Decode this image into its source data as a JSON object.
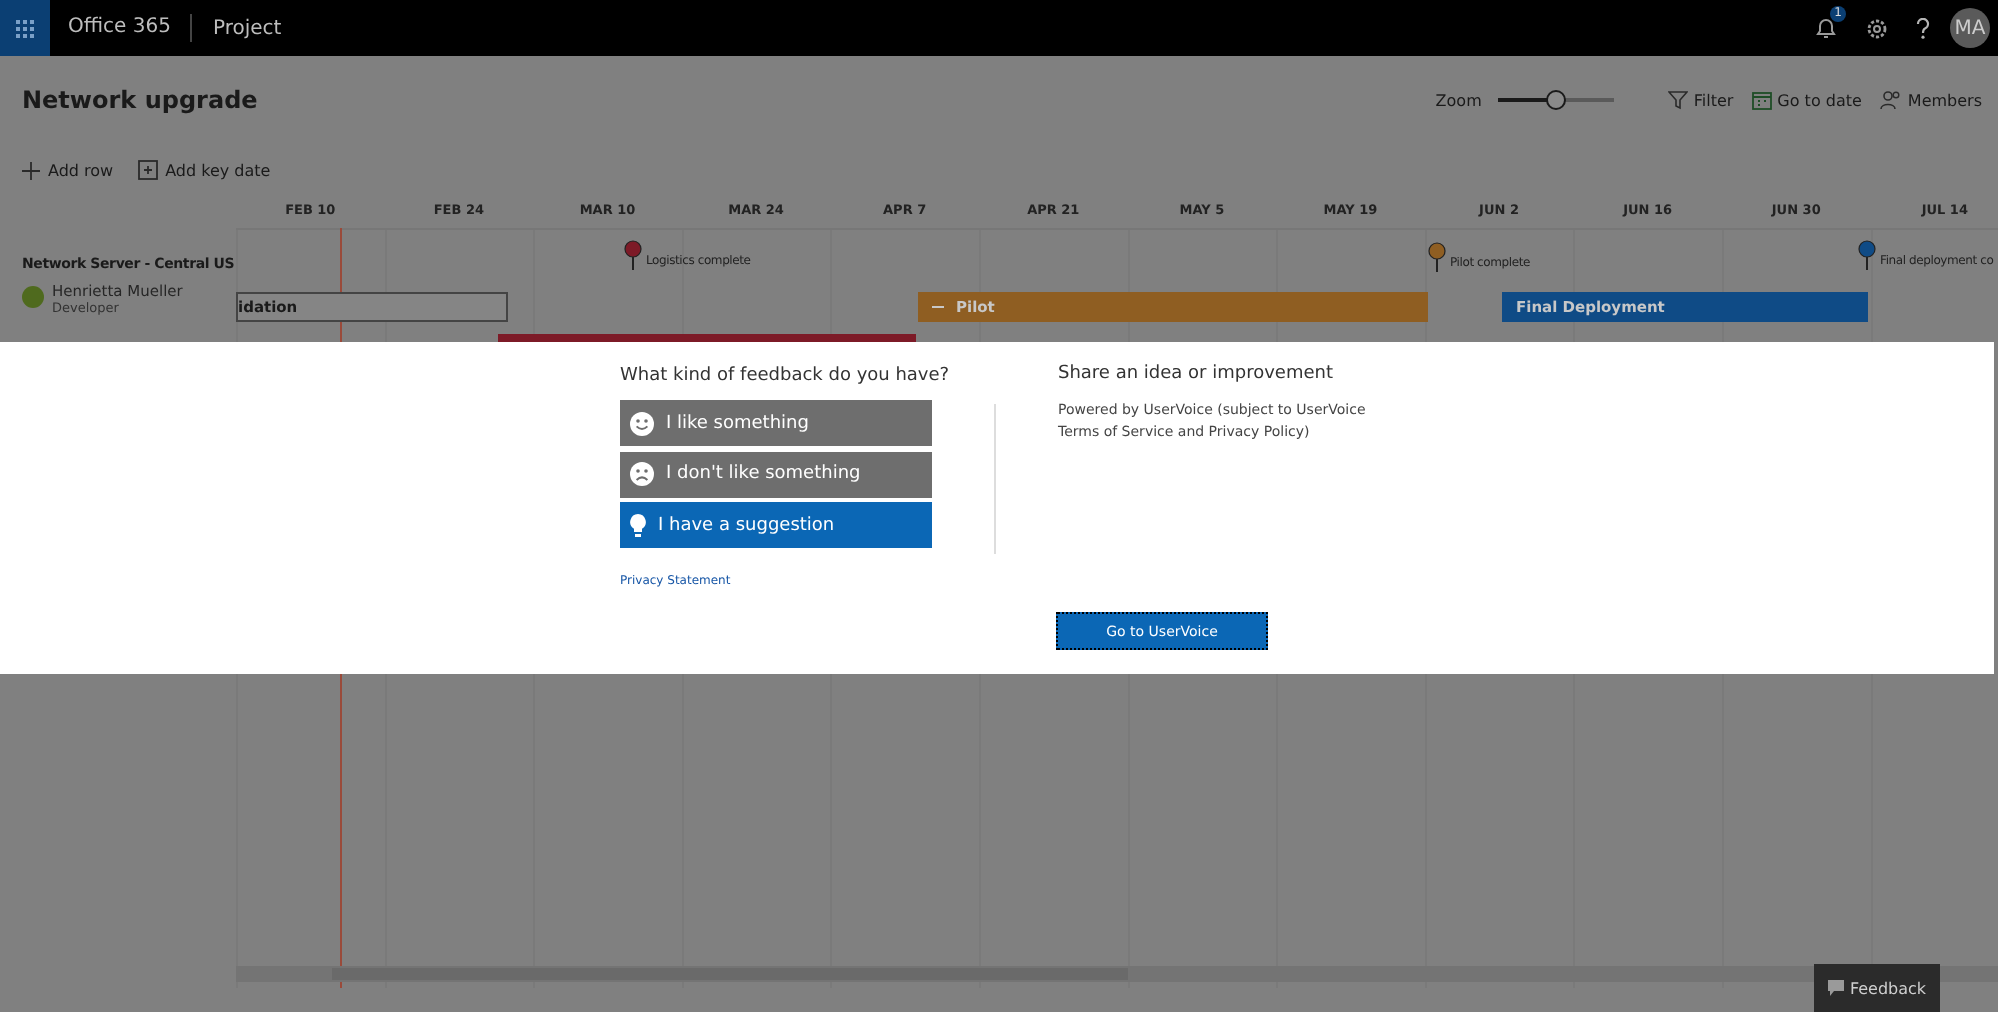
{
  "topbar": {
    "suite": "Office 365",
    "app": "Project",
    "notification_count": "1",
    "avatar": "MA"
  },
  "header": {
    "title": "Network upgrade",
    "zoom": {
      "label": "Zoom",
      "level": 0.5
    },
    "actions": [
      {
        "kind": "filter",
        "label": "Filter"
      },
      {
        "kind": "date",
        "label": "Go to date"
      },
      {
        "kind": "members",
        "label": "Members"
      }
    ]
  },
  "toolbar": [
    {
      "kind": "add",
      "label": "Add row"
    },
    {
      "kind": "keydate",
      "label": "Add key date"
    }
  ],
  "timeline": {
    "dates": [
      "FEB 10",
      "FEB 24",
      "MAR 10",
      "MAR 24",
      "APR 7",
      "APR 21",
      "MAY 5",
      "MAY 19",
      "JUN 2",
      "JUN 16",
      "JUN 30",
      "JUL 14"
    ],
    "row": {
      "name": "Network Server - Central US",
      "owner": "Henrietta Mueller",
      "role": "Developer"
    },
    "milestones": [
      {
        "label": "Logistics complete",
        "color": "#7d1a27"
      },
      {
        "label": "Pilot complete",
        "color": "#8f5e22"
      },
      {
        "label": "Final deployment co",
        "color": "#0f4b86"
      }
    ],
    "bars": [
      {
        "kind": "outlined",
        "label": "idation",
        "color": "#858585"
      },
      {
        "kind": "filled",
        "label": "Pilot",
        "color": "#8f5e22",
        "collapse": true
      },
      {
        "kind": "filled",
        "label": "Final Deployment",
        "color": "#0f4b86",
        "collapse": false
      },
      {
        "kind": "strip",
        "color": "#7d1a27"
      }
    ]
  },
  "feedback_dialog": {
    "question": "What kind of feedback do you have?",
    "options": [
      {
        "kind": "like",
        "label": "I like something",
        "selected": false
      },
      {
        "kind": "dislike",
        "label": "I don't like something",
        "selected": false
      },
      {
        "kind": "suggestion",
        "label": "I have a suggestion",
        "selected": true
      }
    ],
    "privacy_link": "Privacy Statement",
    "heading": "Share an idea or improvement",
    "description": "Powered by UserVoice (subject to UserVoice Terms of Service and Privacy Policy)",
    "button": "Go to UserVoice"
  },
  "feedback_button": "Feedback"
}
